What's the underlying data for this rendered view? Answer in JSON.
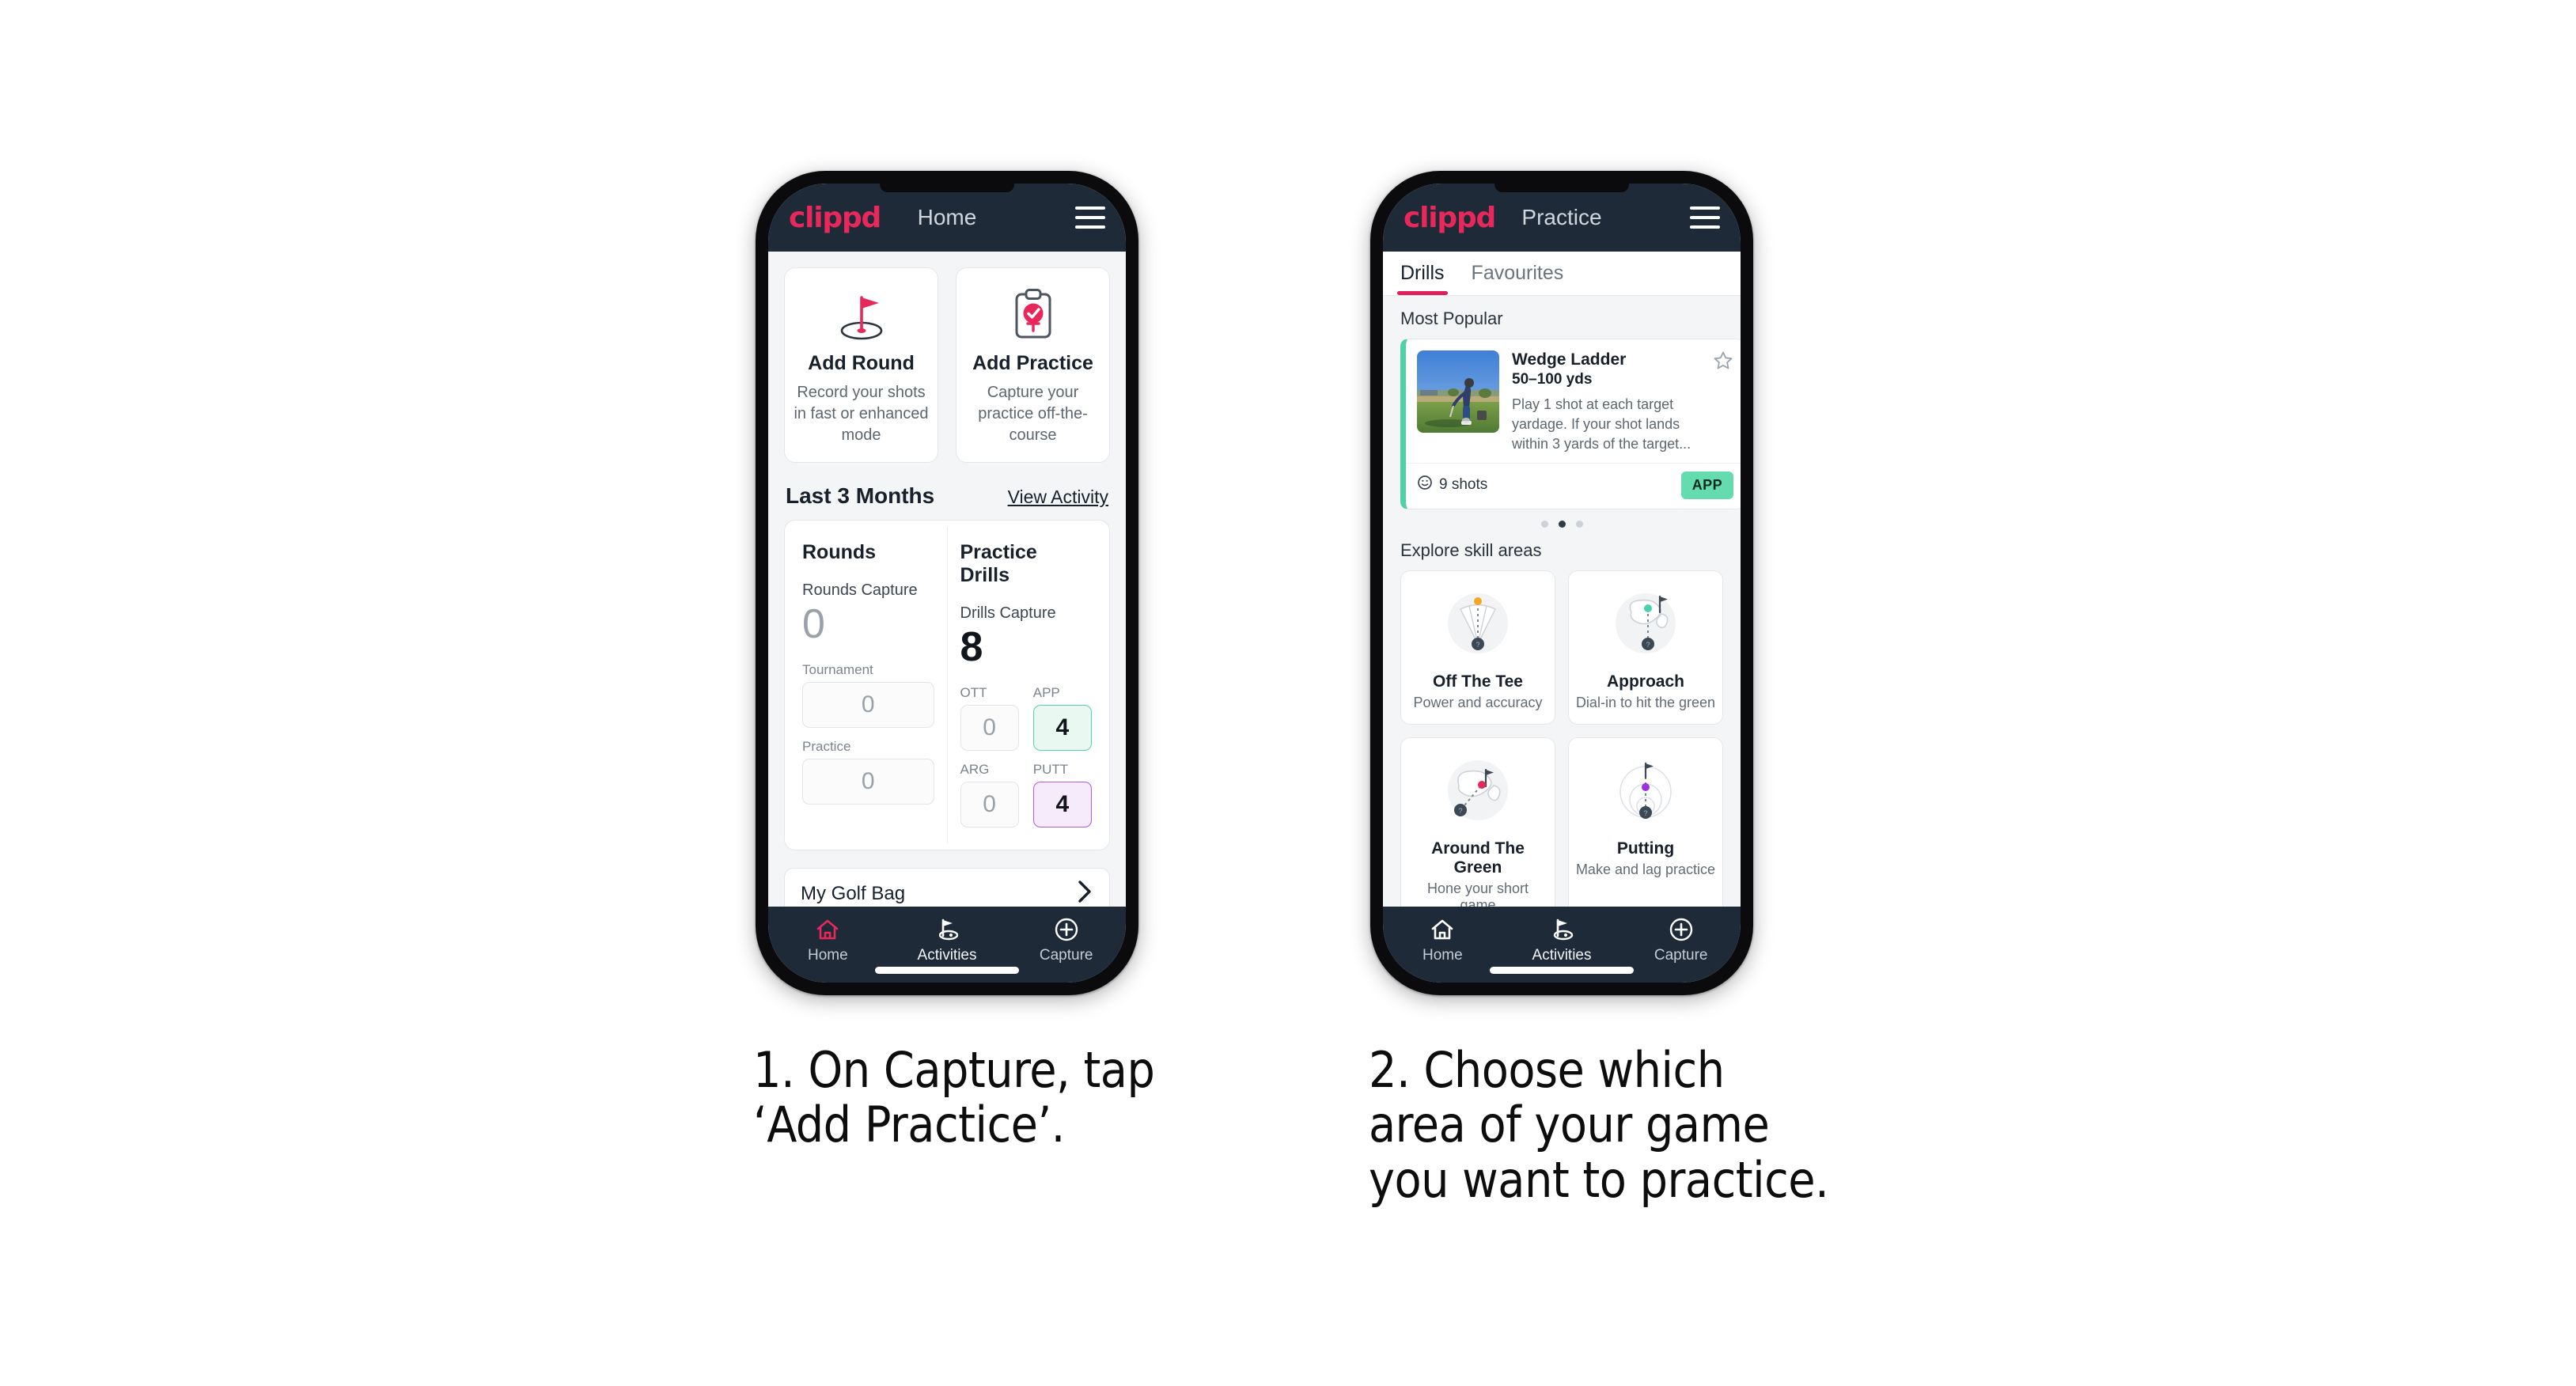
{
  "brand": "clippd",
  "accent": "#e8275a",
  "phones": [
    {
      "id": "home",
      "header": {
        "title": "Home",
        "brand": "clippd",
        "menu_icon": "hamburger-icon"
      },
      "actions": [
        {
          "icon": "flag-in-hole-icon",
          "title": "Add Round",
          "subtitle": "Record your shots in fast or enhanced mode"
        },
        {
          "icon": "clipboard-check-icon",
          "title": "Add Practice",
          "subtitle": "Capture your practice off-the-course"
        }
      ],
      "section": {
        "title": "Last 3 Months",
        "link": "View Activity"
      },
      "stats": [
        {
          "heading": "Rounds",
          "capture_label": "Rounds Capture",
          "capture_value": "0",
          "capture_is_zero": true,
          "minis": [
            {
              "label": "Tournament",
              "value": "0",
              "style": "plain",
              "full": true
            },
            {
              "label": "Practice",
              "value": "0",
              "style": "plain",
              "full": true
            }
          ]
        },
        {
          "heading": "Practice Drills",
          "capture_label": "Drills Capture",
          "capture_value": "8",
          "capture_is_zero": false,
          "minis": [
            {
              "label": "OTT",
              "value": "0",
              "style": "plain",
              "full": false
            },
            {
              "label": "APP",
              "value": "4",
              "style": "green",
              "full": false
            },
            {
              "label": "ARG",
              "value": "0",
              "style": "plain",
              "full": false
            },
            {
              "label": "PUTT",
              "value": "4",
              "style": "purple",
              "full": false
            }
          ]
        }
      ],
      "golf_bag": {
        "label": "My Golf Bag",
        "icon": "chevron-right-icon"
      },
      "nav": [
        {
          "label": "Home",
          "icon": "home-icon",
          "active": true
        },
        {
          "label": "Activities",
          "icon": "flag-hole-icon",
          "active": false
        },
        {
          "label": "Capture",
          "icon": "plus-circle-icon",
          "active": false
        }
      ]
    },
    {
      "id": "practice",
      "header": {
        "title": "Practice",
        "brand": "clippd",
        "menu_icon": "hamburger-icon"
      },
      "tabs": [
        {
          "label": "Drills",
          "active": true
        },
        {
          "label": "Favourites",
          "active": false
        }
      ],
      "most_popular_label": "Most Popular",
      "drill": {
        "name": "Wedge Ladder",
        "yardage": "50–100 yds",
        "description": "Play 1 shot at each target yardage. If your shot lands within 3 yards of the target...",
        "shots": "9 shots",
        "shots_icon": "clock-icon",
        "badge": "APP",
        "badge_color": "#65dcb0",
        "favourite_icon": "star-outline-icon",
        "thumbnail": "golfer-chipping-photo",
        "accent_bar": "#4fd1a5",
        "next_card_accent": "#9b30e0"
      },
      "carousel_dots": {
        "count": 3,
        "active_index": 1
      },
      "skill_heading": "Explore skill areas",
      "skills": [
        {
          "title": "Off The Tee",
          "subtitle": "Power and accuracy",
          "icon": "tee-dispersion-icon",
          "dot_color": "#f5a623"
        },
        {
          "title": "Approach",
          "subtitle": "Dial-in to hit the green",
          "icon": "green-approach-icon",
          "dot_color": "#49d1b0"
        },
        {
          "title": "Around The Green",
          "subtitle": "Hone your short game",
          "icon": "short-game-icon",
          "dot_color": "#e8275a"
        },
        {
          "title": "Putting",
          "subtitle": "Make and lag practice",
          "icon": "putting-rings-icon",
          "dot_color": "#9b30e0"
        }
      ],
      "nav": [
        {
          "label": "Home",
          "icon": "home-icon",
          "active": false
        },
        {
          "label": "Activities",
          "icon": "flag-hole-icon",
          "active": false
        },
        {
          "label": "Capture",
          "icon": "plus-circle-icon",
          "active": false
        }
      ]
    }
  ],
  "captions": [
    {
      "text": "1. On Capture, tap\n‘Add Practice’."
    },
    {
      "text": "2. Choose which\narea of your game\nyou want to practice."
    }
  ]
}
